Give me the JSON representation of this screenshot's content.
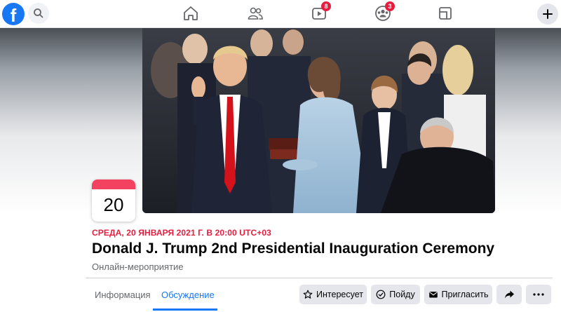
{
  "topbar": {
    "logo_letter": "f",
    "icons": [
      "facebook-logo",
      "search-icon",
      "home-icon",
      "friends-icon",
      "watch-icon",
      "groups-icon",
      "gaming-icon",
      "plus-icon"
    ],
    "watch_badge": "8",
    "groups_badge": "3"
  },
  "cover": {
    "description_icon": "photo"
  },
  "event": {
    "day": "20",
    "date_line": "СРЕДА, 20 ЯНВАРЯ 2021 Г. В 20:00 UTC+03",
    "title": "Donald J. Trump 2nd Presidential Inauguration Ceremony",
    "type": "Онлайн-мероприятие"
  },
  "tabs": [
    {
      "label": "Информация",
      "active": false
    },
    {
      "label": "Обсуждение",
      "active": true
    }
  ],
  "actions": {
    "interested": "Интересует",
    "going": "Пойду",
    "invite": "Пригласить"
  },
  "colors": {
    "brand": "#1877f2",
    "badge": "#e41e3f",
    "date_red": "#e41e3f"
  }
}
